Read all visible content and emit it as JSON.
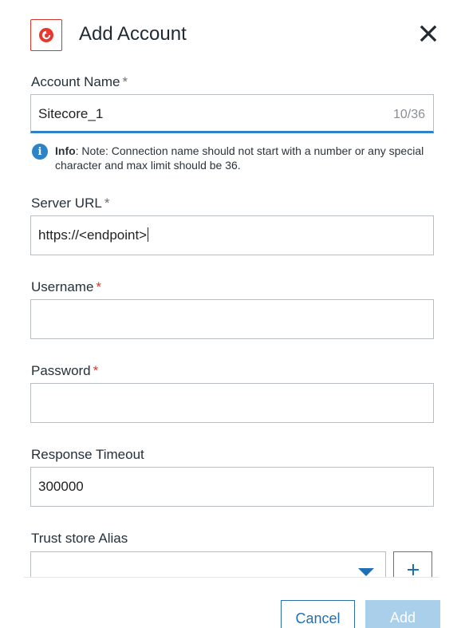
{
  "header": {
    "title": "Add Account",
    "logo_icon": "sitecore-logo-icon",
    "close_icon": "close-icon"
  },
  "account_name": {
    "label": "Account Name",
    "required_mark": "*",
    "value": "Sitecore_1",
    "counter": "10/36"
  },
  "info": {
    "icon": "info-icon",
    "prefix": "Info",
    "text": ": Note: Connection name should not start with a number or any special character and max limit should be 36."
  },
  "server_url": {
    "label": "Server URL",
    "required_mark": "*",
    "value": "https://<endpoint>"
  },
  "username": {
    "label": "Username",
    "required_mark": "*",
    "value": ""
  },
  "password": {
    "label": "Password",
    "required_mark": "*",
    "value": ""
  },
  "response_timeout": {
    "label": "Response Timeout",
    "value": "300000"
  },
  "trust_store": {
    "label": "Trust store Alias",
    "value": "",
    "dropdown_icon": "chevron-down-icon",
    "add_icon": "plus-icon"
  },
  "footer": {
    "cancel_label": "Cancel",
    "add_label": "Add"
  },
  "colors": {
    "accent": "#2d83c6",
    "required": "#d9352b",
    "add_button_disabled": "#a9cfea"
  }
}
